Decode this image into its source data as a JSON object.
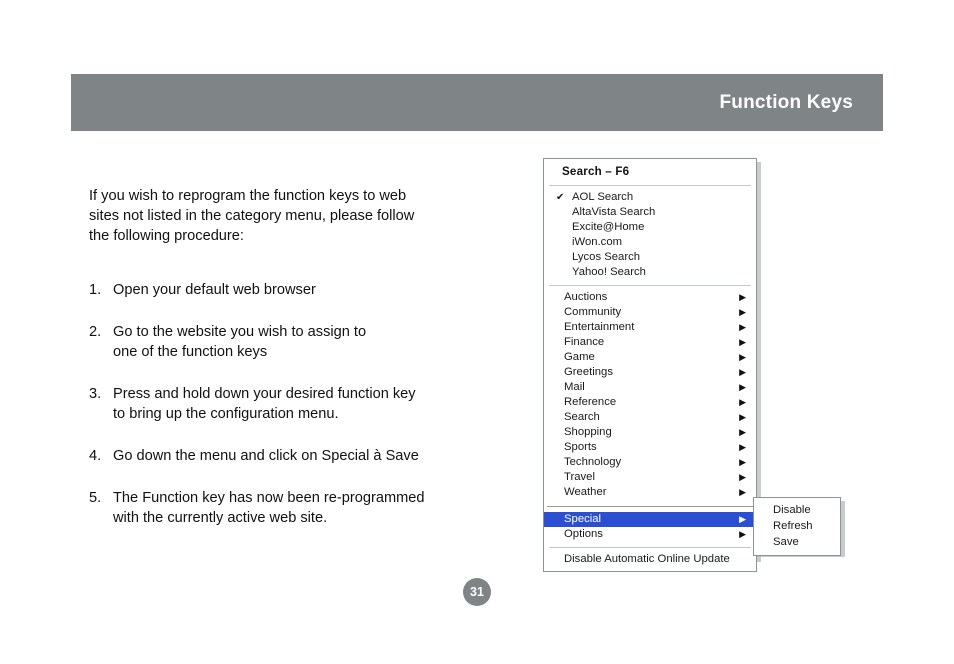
{
  "header": {
    "title": "Function Keys",
    "bar_color": "#7f8487",
    "title_color": "#ffffff"
  },
  "instructions": {
    "intro": "If you wish to reprogram the function keys to web\nsites not listed in the category menu, please follow\nthe following procedure:",
    "steps": [
      {
        "number": "1.",
        "text": "Open your default web browser"
      },
      {
        "number": "2.",
        "text": "Go to the website you wish to assign to\none of the function keys"
      },
      {
        "number": "3.",
        "text": "Press and hold down your desired function key\nto bring up the configuration menu."
      },
      {
        "number": "4.",
        "text": "Go down the menu and click on Special à Save"
      },
      {
        "number": "5.",
        "text": "The Function key has now been re-programmed\nwith the currently active web site."
      }
    ]
  },
  "context_menu": {
    "header": "Search – F6",
    "highlight_color": "#2b4fd0",
    "search_engines": [
      {
        "label": "AOL Search",
        "checked": true,
        "check_icon": "checkmark-icon"
      },
      {
        "label": "AltaVista Search",
        "checked": false
      },
      {
        "label": "Excite@Home",
        "checked": false
      },
      {
        "label": "iWon.com",
        "checked": false
      },
      {
        "label": "Lycos Search",
        "checked": false
      },
      {
        "label": "Yahoo! Search",
        "checked": false
      }
    ],
    "categories": [
      {
        "label": "Auctions",
        "arrow": "submenu-arrow-icon"
      },
      {
        "label": "Community",
        "arrow": "submenu-arrow-icon"
      },
      {
        "label": "Entertainment",
        "arrow": "submenu-arrow-icon"
      },
      {
        "label": "Finance",
        "arrow": "submenu-arrow-icon"
      },
      {
        "label": "Game",
        "arrow": "submenu-arrow-icon"
      },
      {
        "label": "Greetings",
        "arrow": "submenu-arrow-icon"
      },
      {
        "label": "Mail",
        "arrow": "submenu-arrow-icon"
      },
      {
        "label": "Reference",
        "arrow": "submenu-arrow-icon"
      },
      {
        "label": "Search",
        "arrow": "submenu-arrow-icon"
      },
      {
        "label": "Shopping",
        "arrow": "submenu-arrow-icon"
      },
      {
        "label": "Sports",
        "arrow": "submenu-arrow-icon"
      },
      {
        "label": "Technology",
        "arrow": "submenu-arrow-icon"
      },
      {
        "label": "Travel",
        "arrow": "submenu-arrow-icon"
      },
      {
        "label": "Weather",
        "arrow": "submenu-arrow-icon"
      }
    ],
    "special_group": [
      {
        "label": "Special",
        "selected": true,
        "arrow": "submenu-arrow-icon"
      },
      {
        "label": "Options",
        "selected": false,
        "arrow": "submenu-arrow-icon"
      }
    ],
    "footer_item": "Disable Automatic Online Update",
    "arrow_glyph": "▶",
    "check_glyph": "✔"
  },
  "submenu": {
    "items": [
      {
        "label": "Disable"
      },
      {
        "label": "Refresh"
      },
      {
        "label": "Save"
      }
    ]
  },
  "page_number": "31"
}
